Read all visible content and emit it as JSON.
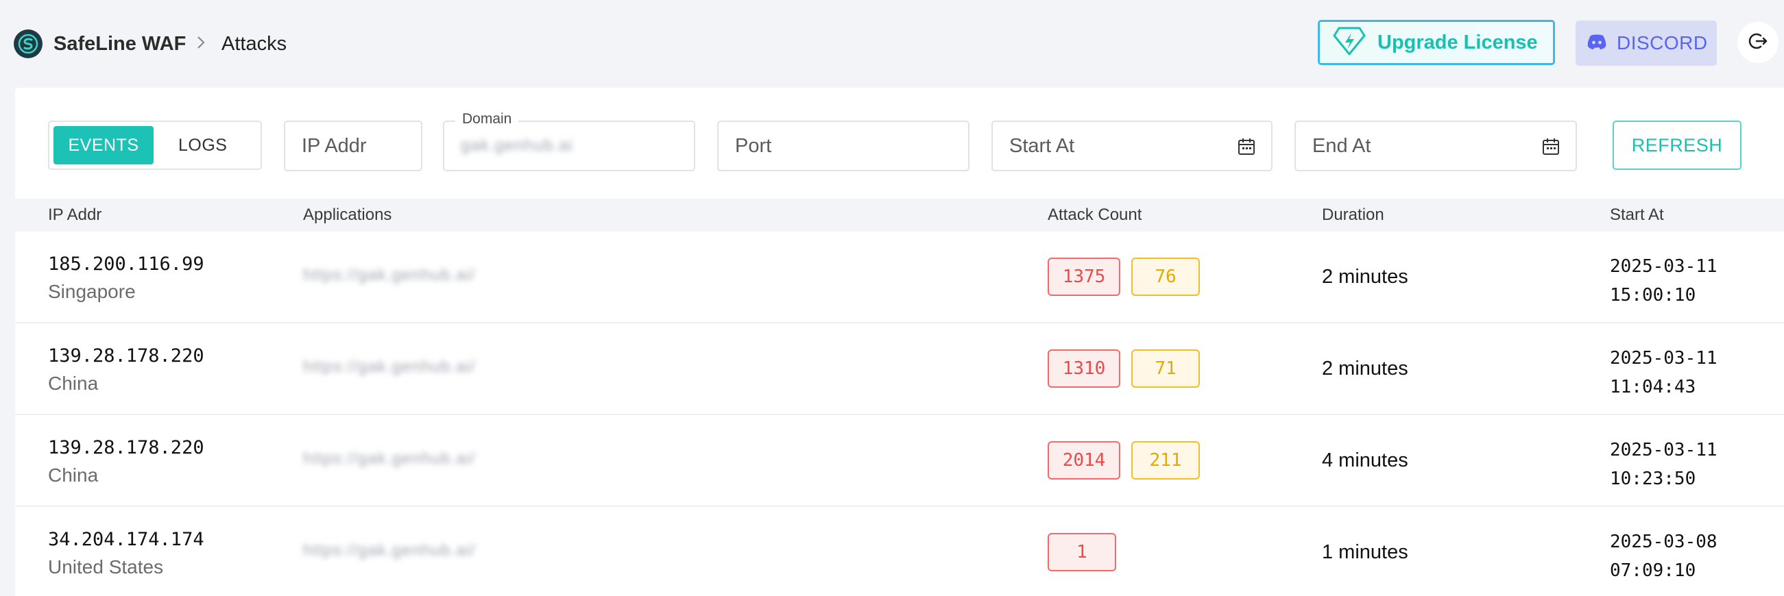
{
  "header": {
    "brand": "SafeLine WAF",
    "breadcrumb_current": "Attacks",
    "upgrade_label": "Upgrade License",
    "discord_label": "DISCORD",
    "icons": {
      "logo": "safeline-logo-icon",
      "upgrade": "diamond-bolt-icon",
      "discord": "discord-icon",
      "logout": "logout-icon",
      "separator": "chevron-right-icon"
    }
  },
  "filters": {
    "tabs": [
      {
        "label": "EVENTS",
        "active": true
      },
      {
        "label": "LOGS",
        "active": false
      }
    ],
    "ip_placeholder": "IP Addr",
    "domain_label": "Domain",
    "domain_value": "gak.genhub.ai",
    "port_placeholder": "Port",
    "start_placeholder": "Start At",
    "end_placeholder": "End At",
    "refresh_label": "REFRESH"
  },
  "table": {
    "columns": [
      "IP Addr",
      "Applications",
      "Attack Count",
      "Duration",
      "Start At"
    ],
    "rows": [
      {
        "ip": "185.200.116.99",
        "country": "Singapore",
        "app": "https://gak.genhub.ai/",
        "count_red": "1375",
        "count_yellow": "76",
        "duration": "2 minutes",
        "start_date": "2025-03-11",
        "start_time": "15:00:10"
      },
      {
        "ip": "139.28.178.220",
        "country": "China",
        "app": "https://gak.genhub.ai/",
        "count_red": "1310",
        "count_yellow": "71",
        "duration": "2 minutes",
        "start_date": "2025-03-11",
        "start_time": "11:04:43"
      },
      {
        "ip": "139.28.178.220",
        "country": "China",
        "app": "https://gak.genhub.ai/",
        "count_red": "2014",
        "count_yellow": "211",
        "duration": "4 minutes",
        "start_date": "2025-03-11",
        "start_time": "10:23:50"
      },
      {
        "ip": "34.204.174.174",
        "country": "United States",
        "app": "https://gak.genhub.ai/",
        "count_red": "1",
        "count_yellow": null,
        "duration": "1 minutes",
        "start_date": "2025-03-08",
        "start_time": "07:09:10"
      }
    ]
  },
  "colors": {
    "accent": "#1dc2b6",
    "danger": "#ea4a4a",
    "warning": "#e5a900",
    "discord": "#5865f2"
  }
}
